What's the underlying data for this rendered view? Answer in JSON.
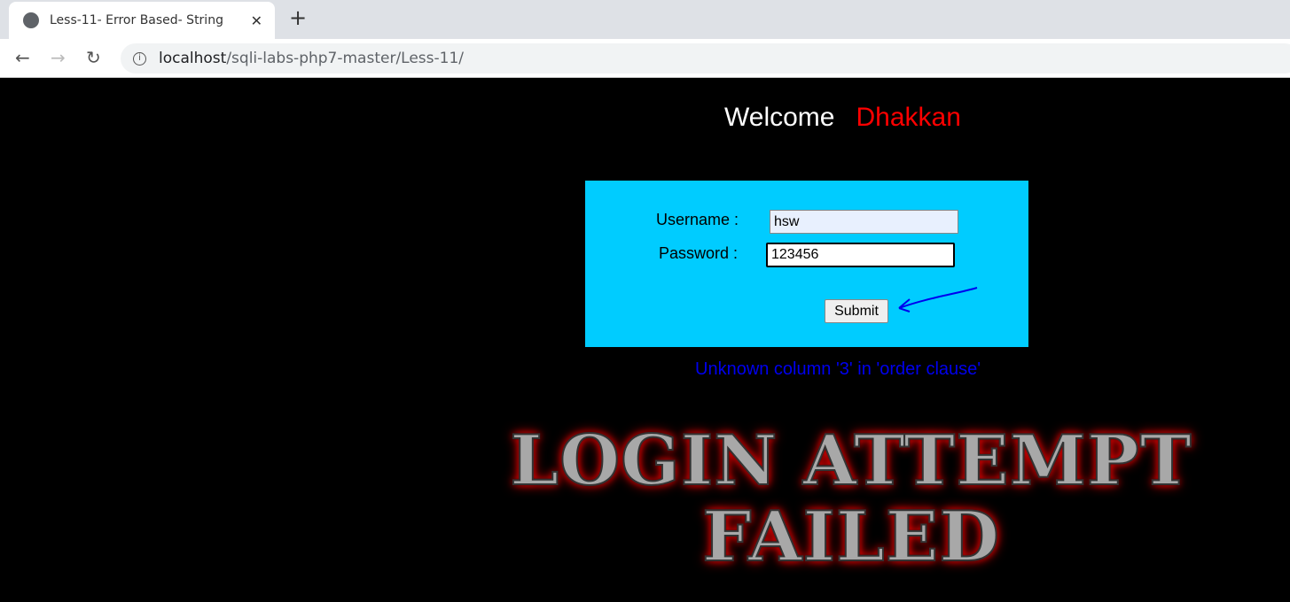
{
  "browser": {
    "tab_title": "Less-11- Error Based- String",
    "url_host": "localhost",
    "url_path": "/sqli-labs-php7-master/Less-11/"
  },
  "page": {
    "welcome": "Welcome",
    "name": "Dhakkan",
    "form": {
      "username_label": "Username :",
      "username_value": "hsw",
      "password_label": "Password :",
      "password_value": "123456",
      "submit_label": "Submit"
    },
    "error_message": "Unknown column '3' in 'order clause'",
    "banner_line1": "LOGIN ATTEMPT",
    "banner_line2": "FAILED"
  },
  "colors": {
    "form_bg": "#00ccff",
    "error": "#0000ee",
    "name": "#ff0000",
    "annotation_arrow": "#0000ee"
  }
}
